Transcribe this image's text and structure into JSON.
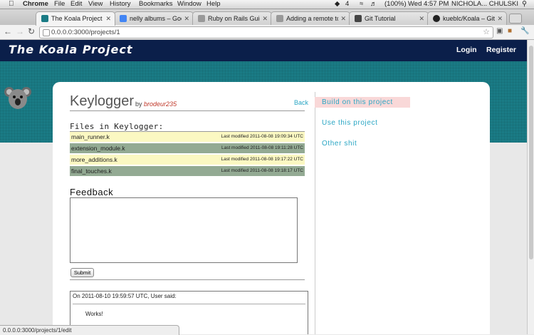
{
  "menubar": {
    "apple": "",
    "app": "Chrome",
    "items": [
      "File",
      "Edit",
      "View",
      "History",
      "Bookmarks",
      "Window",
      "Help"
    ],
    "battery": "(100%)",
    "clock": "Wed 4:57 PM",
    "user": "NICHOLA... CHULSKI",
    "badge": "4"
  },
  "tabs": [
    {
      "title": "The Koala Project",
      "fav_color": "#1a7b85"
    },
    {
      "title": "nelly albums – Google Sea",
      "fav_color": "#4285f4"
    },
    {
      "title": "Ruby on Rails Guides: Rails",
      "fav_color": "#999999"
    },
    {
      "title": "Adding a remote to existin",
      "fav_color": "#999999"
    },
    {
      "title": "Git Tutorial",
      "fav_color": "#444444"
    },
    {
      "title": "kueblc/Koala – GitHub",
      "fav_color": "#222222"
    }
  ],
  "toolbar": {
    "url": "0.0.0.0:3000/projects/1"
  },
  "site": {
    "title": "The Koala Project",
    "login": "Login",
    "register": "Register"
  },
  "project": {
    "name": "Keylogger",
    "by_label": "by",
    "author": "brodeur235",
    "back": "Back",
    "files_heading": "Files in Keylogger:",
    "files": [
      {
        "name": "main_runner.k",
        "modified": "Last modified 2011-08-08 19:09:34 UTC",
        "color": "#fbf8c2"
      },
      {
        "name": "extension_module.k",
        "modified": "Last modified 2011-08-08 19:11:28 UTC",
        "color": "#93aa93"
      },
      {
        "name": "more_additions.k",
        "modified": "Last modified 2011-08-08 19:17:22 UTC",
        "color": "#fbf8c2"
      },
      {
        "name": "final_touches.k",
        "modified": "Last modified 2011-08-08 19:18:17 UTC",
        "color": "#93aa93"
      }
    ]
  },
  "feedback": {
    "heading": "Feedback",
    "submit": "Submit",
    "comment_meta": "On 2011-08-10 19:59:57 UTC, User said:",
    "comment_body": "Works!"
  },
  "sidebar": {
    "links": [
      "Build on this project",
      "Use this project",
      "Other shit"
    ]
  },
  "status": "0.0.0.0:3000/projects/1/edit"
}
